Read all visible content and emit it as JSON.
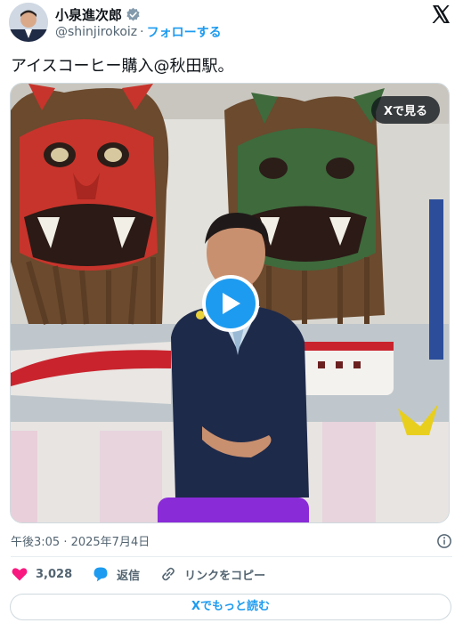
{
  "author": {
    "name": "小泉進次郎",
    "handle": "@shinjirokoiz",
    "separator": "·",
    "follow_label": "フォローする"
  },
  "tweet": {
    "text": "アイスコーヒー購入@秋田駅。",
    "timestamp": "午後3:05 · 2025年7月4日"
  },
  "media": {
    "view_on_x_label": "Xで見る"
  },
  "actions": {
    "likes_count": "3,028",
    "reply_label": "返信",
    "copy_link_label": "リンクをコピー"
  },
  "footer": {
    "read_more_label": "Xでもっと読む"
  },
  "colors": {
    "accent": "#1d9bf0",
    "like": "#f91880",
    "muted": "#536471"
  }
}
